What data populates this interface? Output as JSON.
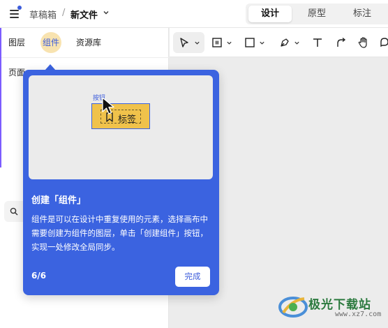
{
  "header": {
    "breadcrumb_drafts": "草稿箱",
    "breadcrumb_sep": "/",
    "file_name": "新文件",
    "modes": [
      {
        "label": "设计",
        "active": true
      },
      {
        "label": "原型",
        "active": false
      },
      {
        "label": "标注",
        "active": false
      }
    ]
  },
  "left_panel": {
    "tabs": {
      "layers": "图层",
      "components": "组件",
      "library": "资源库"
    },
    "pages_label": "页面"
  },
  "toolbar": {
    "tools": [
      "pointer-icon",
      "frame-icon",
      "rectangle-icon",
      "pen-icon",
      "text-icon",
      "connector-icon",
      "hand-icon",
      "comment-icon"
    ]
  },
  "popover": {
    "preview": {
      "caption": "按钮",
      "component_label": "标签"
    },
    "title": "创建「组件」",
    "body": "组件是可以在设计中重复使用的元素，选择画布中需要创建为组件的图层，单击「创建组件」按钮，实现一处修改全局同步。",
    "step": "6/6",
    "done_label": "完成"
  },
  "watermark": {
    "text": "极光下载站",
    "url": "www.xz7.com"
  },
  "colors": {
    "accent": "#3b63e0",
    "component_fill": "#f0c24b",
    "tab_highlight": "#f8e3b0",
    "watermark_green": "#2c7a3f"
  }
}
